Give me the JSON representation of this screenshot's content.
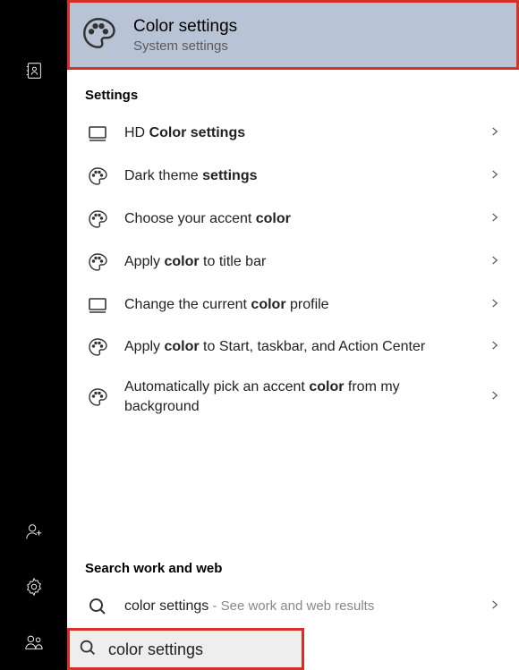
{
  "sidebar": {
    "top_icon": "contacts-icon",
    "bottom": [
      {
        "name": "add-person-icon"
      },
      {
        "name": "settings-gear-icon"
      },
      {
        "name": "people-icon"
      }
    ]
  },
  "best_match": {
    "title": "Color settings",
    "subtitle": "System settings",
    "icon": "palette-icon"
  },
  "sections": {
    "settings_header": "Settings",
    "web_header": "Search work and web"
  },
  "results": [
    {
      "icon": "monitor-icon",
      "html": "HD <b>Color settings</b>"
    },
    {
      "icon": "palette-icon",
      "html": "Dark theme <b>settings</b>"
    },
    {
      "icon": "palette-icon",
      "html": "Choose your accent <b>color</b>"
    },
    {
      "icon": "palette-icon",
      "html": "Apply <b>color</b> to title bar"
    },
    {
      "icon": "monitor-icon",
      "html": "Change the current <b>color</b> profile"
    },
    {
      "icon": "palette-icon",
      "html": "Apply <b>color</b> to Start, taskbar, and Action Center",
      "twoLine": true
    },
    {
      "icon": "palette-icon",
      "html": "Automatically pick an accent <b>color</b> from my background",
      "twoLine": true
    }
  ],
  "web_result": {
    "icon": "search-icon",
    "query": "color settings",
    "hint": " - See work and web results"
  },
  "search": {
    "icon": "search-icon",
    "text": "color settings"
  }
}
